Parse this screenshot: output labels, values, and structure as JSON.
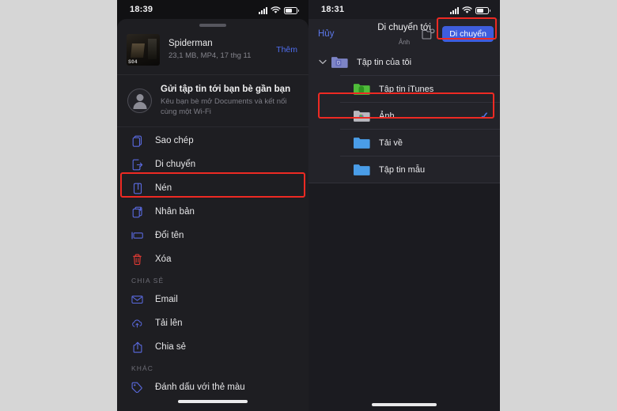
{
  "left_phone": {
    "status": {
      "time": "18:39",
      "signal_icon": "cellular-bars-icon",
      "wifi_icon": "wifi-icon",
      "battery_icon": "battery-icon"
    },
    "file": {
      "thumbnail_label": "S04",
      "name": "Spiderman",
      "details": "23,1 MB, MP4, 17 thg 11",
      "more_label": "Thêm"
    },
    "nearby": {
      "title": "Gửi tập tin tới bạn bè gần bạn",
      "subtitle": "Kêu bạn bè mở Documents và kết nối cùng một Wi-Fi",
      "avatar_icon": "person-icon"
    },
    "actions": [
      {
        "label": "Sao chép",
        "icon": "copy-icon"
      },
      {
        "label": "Di chuyển",
        "icon": "move-icon",
        "highlighted": true
      },
      {
        "label": "Nén",
        "icon": "compress-icon"
      },
      {
        "label": "Nhân bản",
        "icon": "duplicate-icon"
      },
      {
        "label": "Đổi tên",
        "icon": "rename-icon"
      },
      {
        "label": "Xóa",
        "icon": "trash-icon"
      }
    ],
    "share_section": {
      "header": "CHIA SẺ",
      "items": [
        {
          "label": "Email",
          "icon": "envelope-icon"
        },
        {
          "label": "Tải lên",
          "icon": "cloud-upload-icon"
        },
        {
          "label": "Chia sẻ",
          "icon": "share-icon"
        }
      ]
    },
    "other_section": {
      "header": "KHÁC",
      "items": [
        {
          "label": "Đánh dấu với thẻ màu",
          "icon": "tag-icon"
        }
      ]
    }
  },
  "right_phone": {
    "status": {
      "time": "18:31",
      "signal_icon": "cellular-bars-icon",
      "wifi_icon": "wifi-icon",
      "battery_icon": "battery-icon"
    },
    "navbar": {
      "cancel_label": "Hủy",
      "title": "Di chuyển tới",
      "subtitle": "Ảnh",
      "new_folder_icon": "new-folder-icon",
      "move_label": "Di chuyển"
    },
    "tree": [
      {
        "label": "Tập tin của tôi",
        "icon": "documents-folder-icon",
        "expanded": true,
        "level": 0,
        "selected": false
      },
      {
        "label": "Tập tin iTunes",
        "icon": "itunes-folder-icon",
        "level": 1,
        "selected": false
      },
      {
        "label": "Ảnh",
        "icon": "photos-folder-icon",
        "level": 1,
        "selected": true,
        "highlighted": true
      },
      {
        "label": "Tải về",
        "icon": "blue-folder-icon",
        "level": 1,
        "selected": false
      },
      {
        "label": "Tập tin mẫu",
        "icon": "blue-folder-icon",
        "level": 1,
        "selected": false
      }
    ]
  },
  "colors": {
    "accent_blue": "#3e5ddd",
    "link_blue": "#5c78ea",
    "highlight_red": "#ee2a23",
    "page_background": "#d6d6d6",
    "panel_background": "#1e1e22"
  }
}
